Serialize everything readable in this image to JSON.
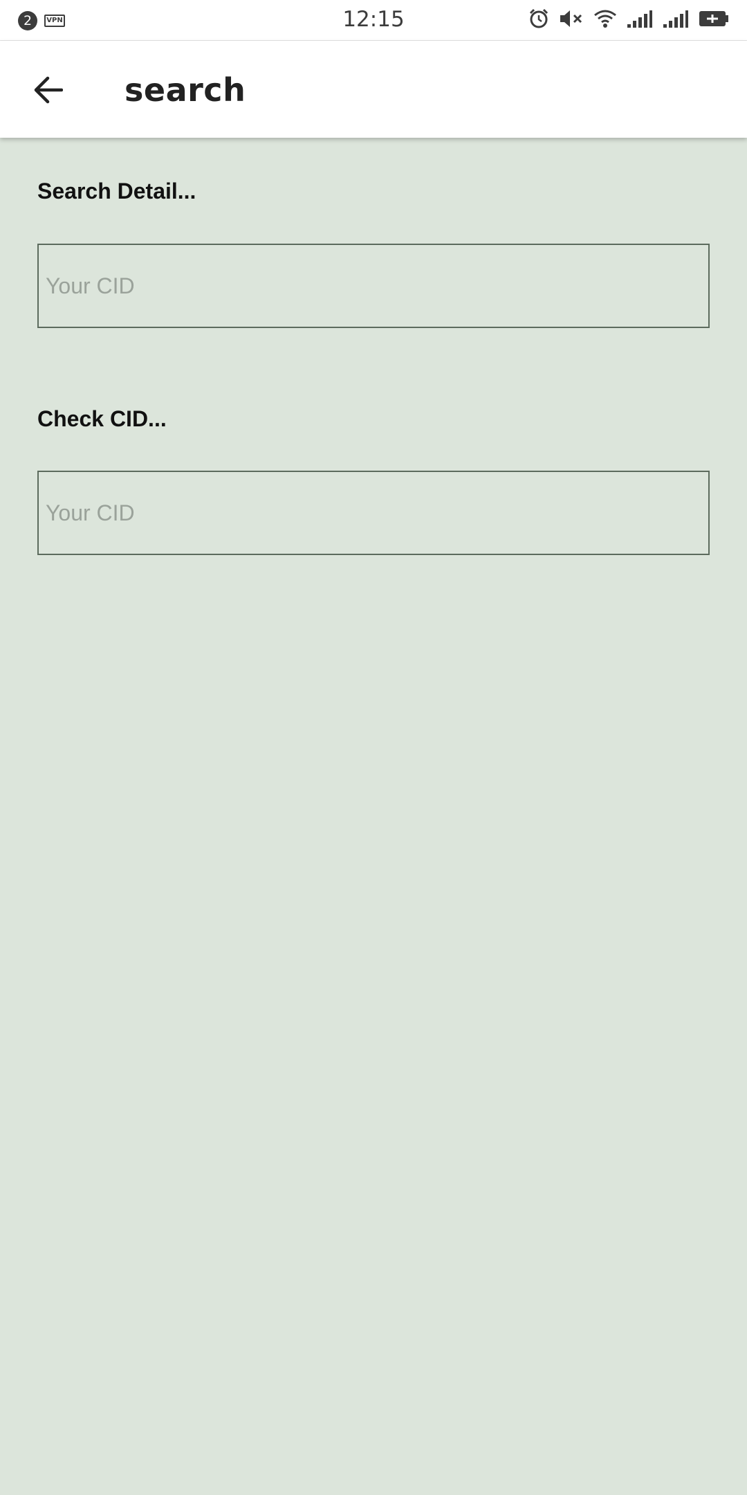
{
  "status_bar": {
    "notification_count": "2",
    "vpn_label": "VPN",
    "time": "12:15",
    "icons": [
      "alarm-icon",
      "mute-icon",
      "wifi-icon",
      "signal-1-icon",
      "signal-2-icon",
      "battery-charging-icon"
    ]
  },
  "app_bar": {
    "title": "search",
    "back_icon": "arrow-back-icon"
  },
  "sections": {
    "search_detail": {
      "label": "Search Detail...",
      "input_value": "",
      "input_placeholder": "Your CID"
    },
    "check_cid": {
      "label": "Check CID...",
      "input_value": "",
      "input_placeholder": "Your CID"
    }
  },
  "colors": {
    "background": "#dce5db",
    "app_bar": "#ffffff",
    "field_border": "#5c6b5d",
    "placeholder": "#9aa29a"
  }
}
